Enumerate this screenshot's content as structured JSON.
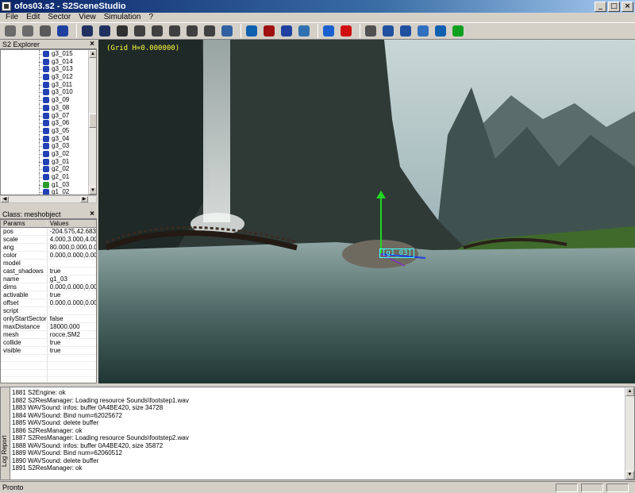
{
  "window": {
    "title": "ofos03.s2 - S2SceneStudio",
    "min": "_",
    "max": "□",
    "close": "×"
  },
  "menu": [
    "File",
    "Edit",
    "Sector",
    "View",
    "Simulation",
    "?"
  ],
  "toolbar": [
    {
      "name": "new-icon",
      "color": "#6b6b6b"
    },
    {
      "name": "open-icon",
      "color": "#6b6b6b"
    },
    {
      "name": "save-icon",
      "color": "#5a5a5a"
    },
    {
      "name": "help-icon",
      "color": "#2040a0"
    },
    {
      "sep": true
    },
    {
      "name": "tool-1-icon",
      "color": "#203060"
    },
    {
      "name": "tool-2-icon",
      "color": "#203060"
    },
    {
      "name": "tool-3-icon",
      "color": "#303030"
    },
    {
      "name": "camera-icon",
      "color": "#404040"
    },
    {
      "name": "rotate-icon",
      "color": "#404040"
    },
    {
      "name": "move-icon",
      "color": "#404040"
    },
    {
      "name": "zoom-icon",
      "color": "#404040"
    },
    {
      "name": "tool-4-icon",
      "color": "#404040"
    },
    {
      "name": "tool-5-icon",
      "color": "#3060a0"
    },
    {
      "sep": true
    },
    {
      "name": "globe-icon",
      "color": "#1060b0"
    },
    {
      "name": "book-icon",
      "color": "#a01010"
    },
    {
      "name": "tool-6-icon",
      "color": "#2040a0"
    },
    {
      "name": "grid-icon",
      "color": "#3070b0"
    },
    {
      "sep": true
    },
    {
      "name": "play-icon",
      "color": "#1a60d0"
    },
    {
      "name": "stop-icon",
      "color": "#d01010"
    },
    {
      "sep": true
    },
    {
      "name": "tool-7-icon",
      "color": "#505050"
    },
    {
      "name": "ren-icon",
      "color": "#2050a0"
    },
    {
      "name": "obj-icon",
      "color": "#2050a0"
    },
    {
      "name": "move-cross-icon",
      "color": "#3070c0"
    },
    {
      "name": "refresh-icon",
      "color": "#1060b0"
    },
    {
      "name": "record-icon",
      "color": "#10a020"
    }
  ],
  "explorer": {
    "title": "S2 Explorer",
    "close": "×",
    "items": [
      "g3_015",
      "g3_014",
      "g3_013",
      "g3_012",
      "g3_011",
      "g3_010",
      "g3_09",
      "g3_08",
      "g3_07",
      "g3_06",
      "g3_05",
      "g3_04",
      "g3_03",
      "g3_02",
      "g3_01",
      "g2_02",
      "g2_01",
      "g1_03",
      "g1_02"
    ],
    "selected": "g1_03"
  },
  "props": {
    "title": "Class: meshobject",
    "close": "×",
    "headers": [
      "Params",
      "Values"
    ],
    "rows": [
      [
        "pos",
        "-204.575,42.683,"
      ],
      [
        "scale",
        "4.000,3.000,4.00"
      ],
      [
        "ang",
        "80.000,0.000,0.0"
      ],
      [
        "color",
        "0.000,0.000,0.00"
      ],
      [
        "model",
        ""
      ],
      [
        "cast_shadows",
        "true"
      ],
      [
        "name",
        "g1_03"
      ],
      [
        "dims",
        "0.000,0.000,0.00"
      ],
      [
        "activable",
        "true"
      ],
      [
        "offset",
        "0.000,0.000,0.00"
      ],
      [
        "script",
        ""
      ],
      [
        "onlyStartSector",
        "false"
      ],
      [
        "maxDistance",
        "18000.000"
      ],
      [
        "mesh",
        "rocce.SM2"
      ],
      [
        "collide",
        "true"
      ],
      [
        "visible",
        "true"
      ]
    ]
  },
  "viewport": {
    "grid_label": "(Grid H=0.000000)",
    "object_label": "[g1_03]"
  },
  "log": {
    "tab": "Log Report",
    "lines": [
      "1881 S2Engine: ok",
      "1882 S2ResManager: Loading resource Sounds\\footstep1.wav",
      "1883 WAVSound: infos: buffer 0A4BE420, size 34728",
      "1884 WAVSound: Bind num=62025672",
      "1885 WAVSound: delete buffer",
      "1886 S2ResManager: ok",
      "1887 S2ResManager: Loading resource Sounds\\footstep2.wav",
      "1888 WAVSound: infos: buffer 0A4BE420, size 35872",
      "1889 WAVSound: Bind num=62060512",
      "1890 WAVSound: delete buffer",
      "1891 S2ResManager: ok"
    ]
  },
  "status": {
    "text": "Pronto"
  }
}
